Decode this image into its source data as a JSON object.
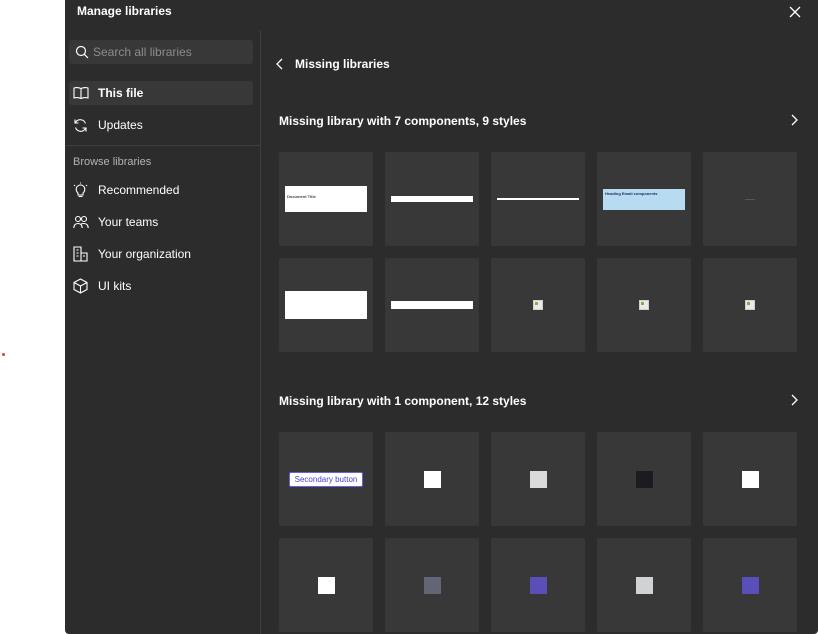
{
  "dialog": {
    "title": "Manage libraries"
  },
  "search": {
    "placeholder": "Search all libraries"
  },
  "sidebar": {
    "items": [
      {
        "label": "This file",
        "icon": "book-icon",
        "active": true
      },
      {
        "label": "Updates",
        "icon": "refresh-icon",
        "active": false
      }
    ],
    "browse_label": "Browse libraries",
    "browse_items": [
      {
        "label": "Recommended",
        "icon": "lightbulb-icon"
      },
      {
        "label": "Your teams",
        "icon": "people-icon"
      },
      {
        "label": "Your organization",
        "icon": "building-icon"
      },
      {
        "label": "UI kits",
        "icon": "cube-icon"
      }
    ]
  },
  "main": {
    "back_label": "Missing libraries",
    "libraries": [
      {
        "heading": "Missing library with 7 components, 9 styles",
        "tiles": [
          {
            "kind": "document-thumb",
            "text": "Document Title"
          },
          {
            "kind": "bar-thumb"
          },
          {
            "kind": "line-thumb"
          },
          {
            "kind": "banner-thumb",
            "text": "Heading Email components"
          },
          {
            "kind": "empty-thumb"
          },
          {
            "kind": "small-doc-thumb"
          },
          {
            "kind": "bar-thumb-2"
          },
          {
            "kind": "broken-image"
          },
          {
            "kind": "broken-image"
          },
          {
            "kind": "broken-image"
          }
        ]
      },
      {
        "heading": "Missing library with 1 component, 12 styles",
        "component_button_label": "Secondary button",
        "swatches": [
          "#ffffff",
          "#d9dadb",
          "#1d1b22",
          "#ffffff",
          "#ffffff",
          "#626573",
          "#5a4fb8",
          "#d0d2d3",
          "#5a4fb8"
        ]
      }
    ]
  },
  "colors": {
    "background": "#2c2c2c",
    "tile": "#383838",
    "accent": "#5a4fb8"
  }
}
